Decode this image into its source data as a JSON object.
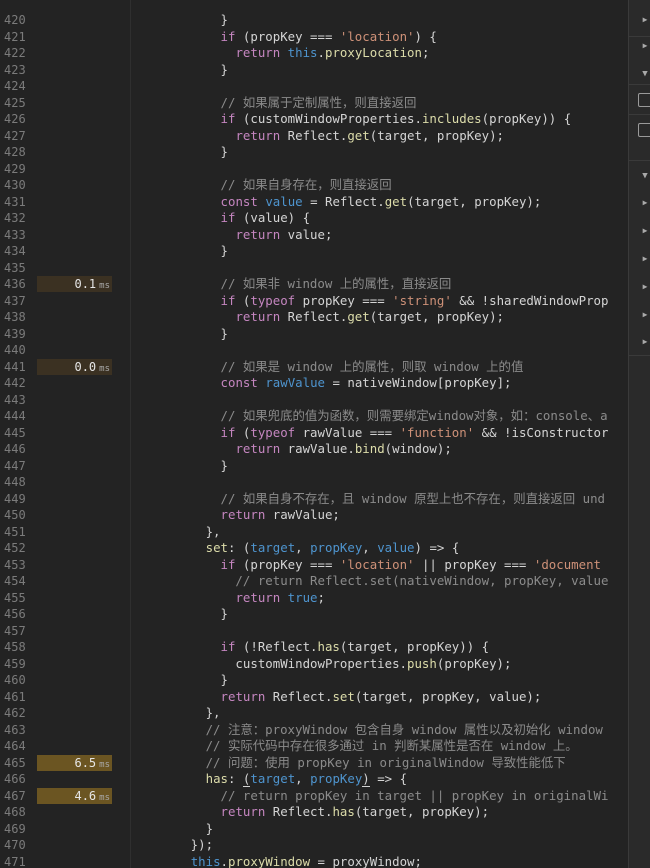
{
  "editor": {
    "lines": [
      {
        "num": "420",
        "timing": "",
        "tokens": [
          {
            "t": "            }",
            "c": ""
          }
        ]
      },
      {
        "num": "421",
        "timing": "",
        "tokens": [
          {
            "t": "            ",
            "c": ""
          },
          {
            "t": "if",
            "c": "kw"
          },
          {
            "t": " (propKey === ",
            "c": ""
          },
          {
            "t": "'location'",
            "c": "str"
          },
          {
            "t": ") {",
            "c": ""
          }
        ]
      },
      {
        "num": "422",
        "timing": "",
        "tokens": [
          {
            "t": "              ",
            "c": ""
          },
          {
            "t": "return",
            "c": "kw"
          },
          {
            "t": " ",
            "c": ""
          },
          {
            "t": "this",
            "c": "bl"
          },
          {
            "t": ".",
            "c": ""
          },
          {
            "t": "proxyLocation",
            "c": "fn"
          },
          {
            "t": ";",
            "c": ""
          }
        ]
      },
      {
        "num": "423",
        "timing": "",
        "tokens": [
          {
            "t": "            }",
            "c": ""
          }
        ]
      },
      {
        "num": "424",
        "timing": "",
        "tokens": []
      },
      {
        "num": "425",
        "timing": "",
        "tokens": [
          {
            "t": "            // 如果属于定制属性，则直接返回",
            "c": "cm"
          }
        ]
      },
      {
        "num": "426",
        "timing": "",
        "tokens": [
          {
            "t": "            ",
            "c": ""
          },
          {
            "t": "if",
            "c": "kw"
          },
          {
            "t": " (customWindowProperties.",
            "c": ""
          },
          {
            "t": "includes",
            "c": "fn"
          },
          {
            "t": "(propKey)) {",
            "c": ""
          }
        ]
      },
      {
        "num": "427",
        "timing": "",
        "tokens": [
          {
            "t": "              ",
            "c": ""
          },
          {
            "t": "return",
            "c": "kw"
          },
          {
            "t": " Reflect.",
            "c": ""
          },
          {
            "t": "get",
            "c": "fn"
          },
          {
            "t": "(target, propKey);",
            "c": ""
          }
        ]
      },
      {
        "num": "428",
        "timing": "",
        "tokens": [
          {
            "t": "            }",
            "c": ""
          }
        ]
      },
      {
        "num": "429",
        "timing": "",
        "tokens": []
      },
      {
        "num": "430",
        "timing": "",
        "tokens": [
          {
            "t": "            // 如果自身存在，则直接返回",
            "c": "cm"
          }
        ]
      },
      {
        "num": "431",
        "timing": "",
        "tokens": [
          {
            "t": "            ",
            "c": ""
          },
          {
            "t": "const",
            "c": "kw"
          },
          {
            "t": " ",
            "c": ""
          },
          {
            "t": "value",
            "c": "bl"
          },
          {
            "t": " = Reflect.",
            "c": ""
          },
          {
            "t": "get",
            "c": "fn"
          },
          {
            "t": "(target, propKey);",
            "c": ""
          }
        ]
      },
      {
        "num": "432",
        "timing": "",
        "tokens": [
          {
            "t": "            ",
            "c": ""
          },
          {
            "t": "if",
            "c": "kw"
          },
          {
            "t": " (value) {",
            "c": ""
          }
        ]
      },
      {
        "num": "433",
        "timing": "",
        "tokens": [
          {
            "t": "              ",
            "c": ""
          },
          {
            "t": "return",
            "c": "kw"
          },
          {
            "t": " value;",
            "c": ""
          }
        ]
      },
      {
        "num": "434",
        "timing": "",
        "tokens": [
          {
            "t": "            }",
            "c": ""
          }
        ]
      },
      {
        "num": "435",
        "timing": "",
        "tokens": []
      },
      {
        "num": "436",
        "timing": "0.1",
        "tokens": [
          {
            "t": "            // 如果非 window 上的属性，直接返回",
            "c": "cm"
          }
        ]
      },
      {
        "num": "437",
        "timing": "",
        "tokens": [
          {
            "t": "            ",
            "c": ""
          },
          {
            "t": "if",
            "c": "kw"
          },
          {
            "t": " (",
            "c": ""
          },
          {
            "t": "typeof",
            "c": "kw"
          },
          {
            "t": " propKey === ",
            "c": ""
          },
          {
            "t": "'string'",
            "c": "str"
          },
          {
            "t": " && !sharedWindowProp",
            "c": ""
          }
        ]
      },
      {
        "num": "438",
        "timing": "",
        "tokens": [
          {
            "t": "              ",
            "c": ""
          },
          {
            "t": "return",
            "c": "kw"
          },
          {
            "t": " Reflect.",
            "c": ""
          },
          {
            "t": "get",
            "c": "fn"
          },
          {
            "t": "(target, propKey);",
            "c": ""
          }
        ]
      },
      {
        "num": "439",
        "timing": "",
        "tokens": [
          {
            "t": "            }",
            "c": ""
          }
        ]
      },
      {
        "num": "440",
        "timing": "",
        "tokens": []
      },
      {
        "num": "441",
        "timing": "0.0",
        "tokens": [
          {
            "t": "            // 如果是 window 上的属性，则取 window 上的值",
            "c": "cm"
          }
        ]
      },
      {
        "num": "442",
        "timing": "",
        "tokens": [
          {
            "t": "            ",
            "c": ""
          },
          {
            "t": "const",
            "c": "kw"
          },
          {
            "t": " ",
            "c": ""
          },
          {
            "t": "rawValue",
            "c": "bl"
          },
          {
            "t": " = nativeWindow[propKey];",
            "c": ""
          }
        ]
      },
      {
        "num": "443",
        "timing": "",
        "tokens": []
      },
      {
        "num": "444",
        "timing": "",
        "tokens": [
          {
            "t": "            // 如果兜底的值为函数，则需要绑定window对象，如：console、a",
            "c": "cm"
          }
        ]
      },
      {
        "num": "445",
        "timing": "",
        "tokens": [
          {
            "t": "            ",
            "c": ""
          },
          {
            "t": "if",
            "c": "kw"
          },
          {
            "t": " (",
            "c": ""
          },
          {
            "t": "typeof",
            "c": "kw"
          },
          {
            "t": " rawValue === ",
            "c": ""
          },
          {
            "t": "'function'",
            "c": "str"
          },
          {
            "t": " && !isConstructor",
            "c": ""
          }
        ]
      },
      {
        "num": "446",
        "timing": "",
        "tokens": [
          {
            "t": "              ",
            "c": ""
          },
          {
            "t": "return",
            "c": "kw"
          },
          {
            "t": " rawValue.",
            "c": ""
          },
          {
            "t": "bind",
            "c": "fn"
          },
          {
            "t": "(window);",
            "c": ""
          }
        ]
      },
      {
        "num": "447",
        "timing": "",
        "tokens": [
          {
            "t": "            }",
            "c": ""
          }
        ]
      },
      {
        "num": "448",
        "timing": "",
        "tokens": []
      },
      {
        "num": "449",
        "timing": "",
        "tokens": [
          {
            "t": "            // 如果自身不存在，且 window 原型上也不存在，则直接返回 und",
            "c": "cm"
          }
        ]
      },
      {
        "num": "450",
        "timing": "",
        "tokens": [
          {
            "t": "            ",
            "c": ""
          },
          {
            "t": "return",
            "c": "kw"
          },
          {
            "t": " rawValue;",
            "c": ""
          }
        ]
      },
      {
        "num": "451",
        "timing": "",
        "tokens": [
          {
            "t": "          },",
            "c": ""
          }
        ]
      },
      {
        "num": "452",
        "timing": "",
        "tokens": [
          {
            "t": "          ",
            "c": ""
          },
          {
            "t": "set",
            "c": "fn"
          },
          {
            "t": ": (",
            "c": ""
          },
          {
            "t": "target",
            "c": "bl"
          },
          {
            "t": ", ",
            "c": ""
          },
          {
            "t": "propKey",
            "c": "bl"
          },
          {
            "t": ", ",
            "c": ""
          },
          {
            "t": "value",
            "c": "bl"
          },
          {
            "t": ") => {",
            "c": ""
          }
        ]
      },
      {
        "num": "453",
        "timing": "",
        "tokens": [
          {
            "t": "            ",
            "c": ""
          },
          {
            "t": "if",
            "c": "kw"
          },
          {
            "t": " (propKey === ",
            "c": ""
          },
          {
            "t": "'location'",
            "c": "str"
          },
          {
            "t": " || propKey === ",
            "c": ""
          },
          {
            "t": "'document",
            "c": "str"
          }
        ]
      },
      {
        "num": "454",
        "timing": "",
        "tokens": [
          {
            "t": "              // return Reflect.set(nativeWindow, propKey, value",
            "c": "cm"
          }
        ]
      },
      {
        "num": "455",
        "timing": "",
        "tokens": [
          {
            "t": "              ",
            "c": ""
          },
          {
            "t": "return",
            "c": "kw"
          },
          {
            "t": " ",
            "c": ""
          },
          {
            "t": "true",
            "c": "bl"
          },
          {
            "t": ";",
            "c": ""
          }
        ]
      },
      {
        "num": "456",
        "timing": "",
        "tokens": [
          {
            "t": "            }",
            "c": ""
          }
        ]
      },
      {
        "num": "457",
        "timing": "",
        "tokens": []
      },
      {
        "num": "458",
        "timing": "",
        "tokens": [
          {
            "t": "            ",
            "c": ""
          },
          {
            "t": "if",
            "c": "kw"
          },
          {
            "t": " (!Reflect.",
            "c": ""
          },
          {
            "t": "has",
            "c": "fn"
          },
          {
            "t": "(target, propKey)) {",
            "c": ""
          }
        ]
      },
      {
        "num": "459",
        "timing": "",
        "tokens": [
          {
            "t": "              customWindowProperties.",
            "c": ""
          },
          {
            "t": "push",
            "c": "fn"
          },
          {
            "t": "(propKey);",
            "c": ""
          }
        ]
      },
      {
        "num": "460",
        "timing": "",
        "tokens": [
          {
            "t": "            }",
            "c": ""
          }
        ]
      },
      {
        "num": "461",
        "timing": "",
        "tokens": [
          {
            "t": "            ",
            "c": ""
          },
          {
            "t": "return",
            "c": "kw"
          },
          {
            "t": " Reflect.",
            "c": ""
          },
          {
            "t": "set",
            "c": "fn"
          },
          {
            "t": "(target, propKey, value);",
            "c": ""
          }
        ]
      },
      {
        "num": "462",
        "timing": "",
        "tokens": [
          {
            "t": "          },",
            "c": ""
          }
        ]
      },
      {
        "num": "463",
        "timing": "",
        "tokens": [
          {
            "t": "          // 注意：proxyWindow 包含自身 window 属性以及初始化 window",
            "c": "cm"
          }
        ]
      },
      {
        "num": "464",
        "timing": "",
        "tokens": [
          {
            "t": "          // 实际代码中存在很多通过 in 判断某属性是否在 window 上。",
            "c": "cm"
          }
        ]
      },
      {
        "num": "465",
        "timing": "6.5",
        "tokens": [
          {
            "t": "          // 问题：使用 propKey in originalWindow 导致性能低下",
            "c": "cm"
          }
        ]
      },
      {
        "num": "466",
        "timing": "",
        "tokens": [
          {
            "t": "          ",
            "c": ""
          },
          {
            "t": "has",
            "c": "fn"
          },
          {
            "t": ": ",
            "c": ""
          },
          {
            "t": "(",
            "c": "ul"
          },
          {
            "t": "target",
            "c": "bl"
          },
          {
            "t": ", ",
            "c": ""
          },
          {
            "t": "propKey",
            "c": "bl"
          },
          {
            "t": ")",
            "c": "ul"
          },
          {
            "t": " => {",
            "c": ""
          }
        ]
      },
      {
        "num": "467",
        "timing": "4.6",
        "tokens": [
          {
            "t": "            // return propKey in target || propKey in originalWi",
            "c": "cm"
          }
        ]
      },
      {
        "num": "468",
        "timing": "",
        "tokens": [
          {
            "t": "            ",
            "c": ""
          },
          {
            "t": "return",
            "c": "kw"
          },
          {
            "t": " Reflect.",
            "c": ""
          },
          {
            "t": "has",
            "c": "fn"
          },
          {
            "t": "(target, propKey);",
            "c": ""
          }
        ]
      },
      {
        "num": "469",
        "timing": "",
        "tokens": [
          {
            "t": "          }",
            "c": ""
          }
        ]
      },
      {
        "num": "470",
        "timing": "",
        "tokens": [
          {
            "t": "        });",
            "c": ""
          }
        ]
      },
      {
        "num": "471",
        "timing": "",
        "tokens": [
          {
            "t": "        ",
            "c": ""
          },
          {
            "t": "this",
            "c": "bl"
          },
          {
            "t": ".",
            "c": ""
          },
          {
            "t": "proxyWindow",
            "c": "fn"
          },
          {
            "t": " = proxyWindow;",
            "c": ""
          }
        ]
      }
    ],
    "timing_unit": "ms"
  },
  "right_panel": {
    "icons": [
      "expand-arrow-icon",
      "expand-arrow-icon",
      "collapse-arrow-icon",
      "checkbox",
      "checkbox",
      "collapse-arrow-icon",
      "expand-arrow-icon",
      "expand-arrow-icon",
      "expand-arrow-icon",
      "expand-arrow-icon",
      "expand-arrow-icon",
      "expand-arrow-icon",
      "expand-arrow-icon"
    ]
  },
  "colors": {
    "background": "#232323",
    "keyword": "#c586c0",
    "blue": "#4e94ce",
    "function": "#dcdcaa",
    "string": "#ce9178",
    "comment": "#8b8b8b",
    "timing_fast": "#3b3122",
    "timing_slow": "#6b5522"
  }
}
